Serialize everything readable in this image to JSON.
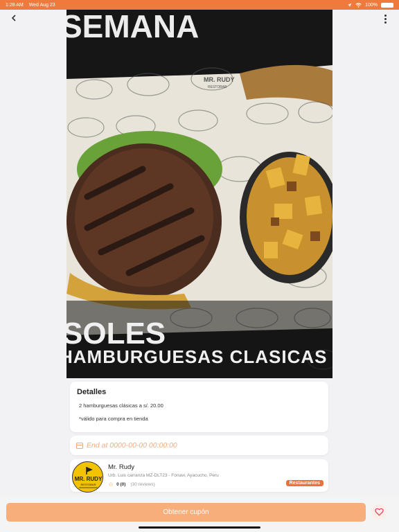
{
  "status_bar": {
    "time": "1:28 AM",
    "date": "Wed Aug 23",
    "battery": "100%"
  },
  "nav": {
    "back_icon": "chevron-left-icon",
    "menu_icon": "more-vertical-icon"
  },
  "hero": {
    "headline_top": "SEMANA",
    "headline_bottom_1": "SOLES",
    "headline_bottom_2": "HAMBURGUESAS CLASICAS",
    "wrapper_brand": "MR. RUDY",
    "wrapper_sub": "RESTOBAR"
  },
  "details": {
    "title": "Detalles",
    "line1": "2 hamburguesas clásicas a s/. 20.00",
    "line2": "*válido para compra en tienda"
  },
  "validity": {
    "placeholder": "End at 0000-00-00 00:00:00",
    "icon": "calendar-icon"
  },
  "business": {
    "logo_text": "MR. RUDY",
    "logo_sub": "RESTOBAR",
    "name": "Mr. Rudy",
    "address": "Urb. Luis carranza MZ-DLT23 - Fonavi, Ayacucho, Peru",
    "rating": "0 (0)",
    "reviews": "(30 reviews)",
    "category": "Restaurantes"
  },
  "cta": {
    "label": "Obtener cupón",
    "favorite_icon": "heart-icon"
  },
  "colors": {
    "accent": "#f07a3c",
    "cta": "#f7ae7a",
    "badge": "#e8743a",
    "logo": "#f3c200"
  }
}
